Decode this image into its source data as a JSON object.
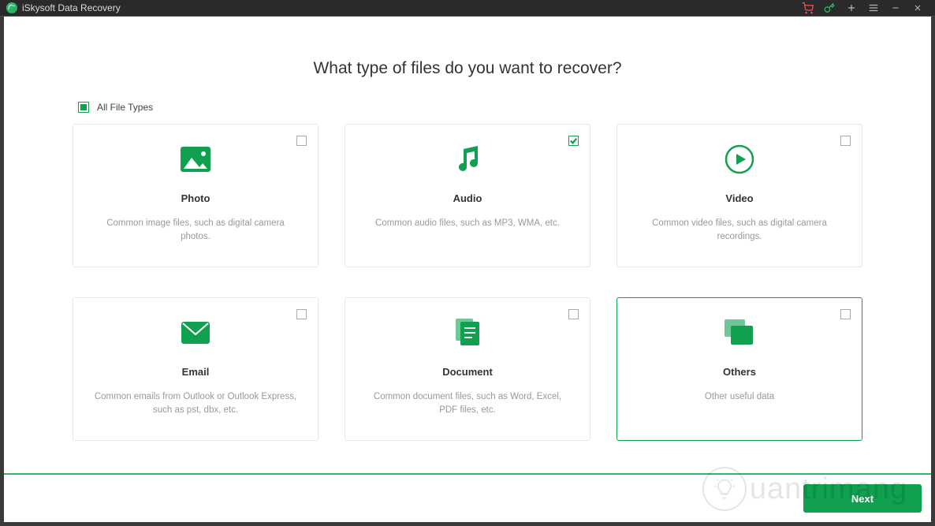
{
  "window": {
    "title": "iSkysoft Data Recovery"
  },
  "page": {
    "heading": "What type of files do you want to recover?",
    "all_types_label": "All File Types"
  },
  "cards": [
    {
      "id": "photo",
      "title": "Photo",
      "desc": "Common image files, such as digital camera photos.",
      "checked": false,
      "selected": false
    },
    {
      "id": "audio",
      "title": "Audio",
      "desc": "Common audio files, such as MP3, WMA, etc.",
      "checked": true,
      "selected": false
    },
    {
      "id": "video",
      "title": "Video",
      "desc": "Common video files, such as digital camera recordings.",
      "checked": false,
      "selected": false
    },
    {
      "id": "email",
      "title": "Email",
      "desc": "Common emails from Outlook or Outlook Express, such as pst, dbx, etc.",
      "checked": false,
      "selected": false
    },
    {
      "id": "document",
      "title": "Document",
      "desc": "Common document files, such as Word, Excel, PDF files, etc.",
      "checked": false,
      "selected": false
    },
    {
      "id": "others",
      "title": "Others",
      "desc": "Other useful data",
      "checked": false,
      "selected": true
    }
  ],
  "footer": {
    "next_label": "Next"
  },
  "watermark": "uantrimang",
  "colors": {
    "accent": "#10a050"
  }
}
